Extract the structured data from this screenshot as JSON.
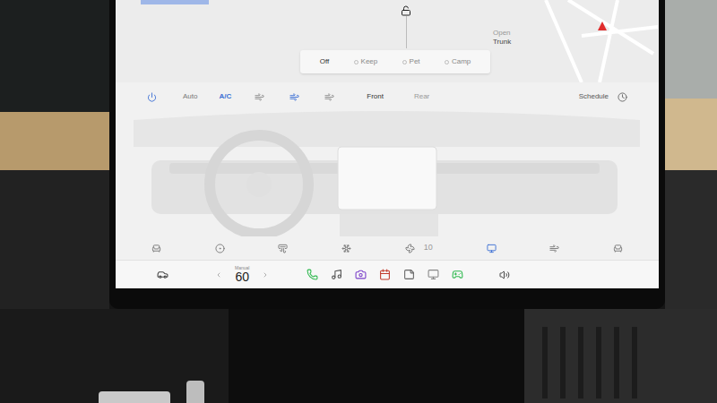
{
  "map": {
    "unlocked": true,
    "trunk_label": [
      "Open",
      "Trunk"
    ]
  },
  "keep_climate_modes": [
    {
      "label": "Off",
      "selected": true
    },
    {
      "label": "Keep",
      "selected": false
    },
    {
      "label": "Pet",
      "selected": false
    },
    {
      "label": "Camp",
      "selected": false
    }
  ],
  "climate": {
    "power": true,
    "auto": {
      "label": "Auto",
      "on": false
    },
    "ac": {
      "label": "A/C",
      "on": true
    },
    "airflow": [
      {
        "selected": false
      },
      {
        "selected": true
      },
      {
        "selected": false
      }
    ],
    "zones": [
      {
        "label": "Front",
        "selected": true
      },
      {
        "label": "Rear",
        "selected": false
      }
    ],
    "schedule": "Schedule",
    "fan_speed": "10"
  },
  "dock": {
    "temperature_mode": "Manual",
    "temperature": "60"
  }
}
